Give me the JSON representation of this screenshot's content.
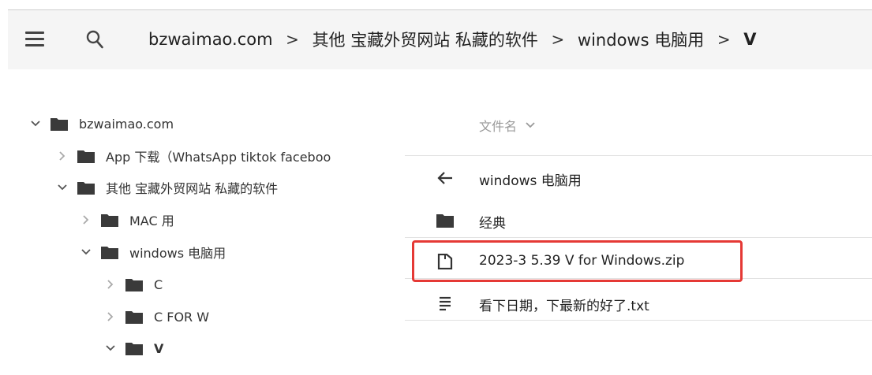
{
  "breadcrumb": {
    "items": [
      "bzwaimao.com",
      "其他 宝藏外贸网站 私藏的软件",
      "windows 电脑用",
      "V"
    ],
    "separator": ">"
  },
  "tree": {
    "items": [
      {
        "label": "bzwaimao.com",
        "expanded": true
      },
      {
        "label": "App 下载（WhatsApp tiktok faceboo",
        "expanded": false
      },
      {
        "label": "其他 宝藏外贸网站 私藏的软件",
        "expanded": true
      },
      {
        "label": "MAC 用",
        "expanded": false
      },
      {
        "label": "windows 电脑用",
        "expanded": true
      },
      {
        "label": "C",
        "expanded": false
      },
      {
        "label": "C FOR W",
        "expanded": false
      },
      {
        "label": "V",
        "expanded": true
      }
    ]
  },
  "list": {
    "sort_label": "文件名",
    "rows": [
      {
        "label": "windows 电脑用",
        "icon": "back-arrow-icon"
      },
      {
        "label": "经典",
        "icon": "folder-icon"
      },
      {
        "label": "2023-3 5.39 V for Windows.zip",
        "icon": "zip-file-icon"
      },
      {
        "label": "看下日期，下最新的好了.txt",
        "icon": "text-file-icon"
      }
    ]
  },
  "colors": {
    "highlight_border": "#e53935",
    "topbar_bg": "#f5f5f5",
    "folder": "#3a3a3a"
  }
}
